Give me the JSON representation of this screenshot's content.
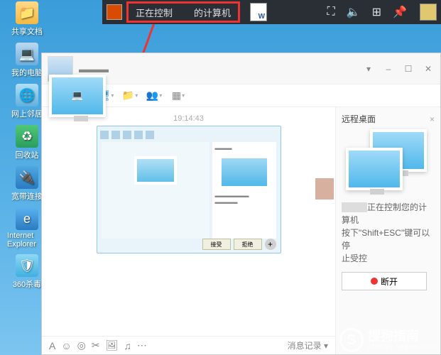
{
  "desktop": {
    "icons": [
      {
        "label": "共享文档",
        "name": "shared-docs-icon",
        "cls": "folder-icon",
        "glyph": "📁"
      },
      {
        "label": "我的电脑",
        "name": "my-computer-icon",
        "cls": "computer-icon",
        "glyph": "💻"
      },
      {
        "label": "网上邻居",
        "name": "network-neighborhood-icon",
        "cls": "network-icon",
        "glyph": "🌐"
      },
      {
        "label": "回收站",
        "name": "recycle-bin-icon",
        "cls": "recycle-icon",
        "glyph": "♻"
      },
      {
        "label": "宽带连接",
        "name": "broadband-icon",
        "cls": "broadband-icon",
        "glyph": "🔌"
      },
      {
        "label": "Internet Explorer",
        "name": "ie-icon",
        "cls": "ie-icon",
        "glyph": "e"
      },
      {
        "label": "360杀毒",
        "name": "antivirus-icon",
        "cls": "sec-icon",
        "glyph": "🛡"
      }
    ]
  },
  "topbar": {
    "highlight_left": "正在控制",
    "highlight_right": "的计算机"
  },
  "chat": {
    "timestamp": "19:14:43",
    "msg_history_label": "消息记录",
    "thumb_btn_accept": "接受",
    "thumb_btn_reject": "拒绝"
  },
  "side": {
    "title": "远程桌面",
    "status_line1": "正在控制您的计",
    "status_line2": "算机",
    "hint_line1": "按下\"Shift+ESC\"键可以停",
    "hint_line2": "止受控",
    "disconnect_label": "断开"
  },
  "watermark": {
    "logo_letter": "S",
    "main": "搜狗指南",
    "sub": "zhinan.sogou.com"
  }
}
